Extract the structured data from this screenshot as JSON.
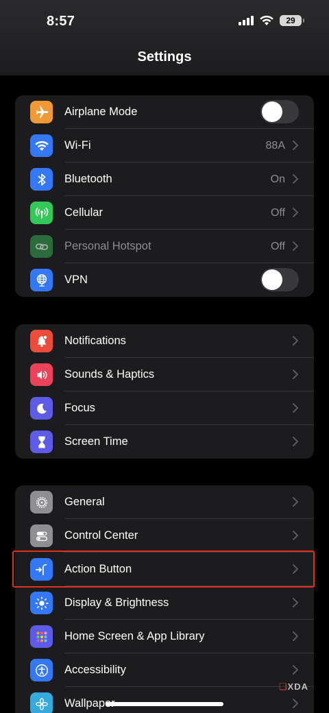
{
  "status_bar": {
    "time": "8:57",
    "battery": "29"
  },
  "page": {
    "title": "Settings"
  },
  "groups": [
    {
      "rows": [
        {
          "label": "Airplane Mode",
          "value": "",
          "icon": "airplane-icon",
          "color": "#f09a37",
          "control": "toggle",
          "toggle_on": false
        },
        {
          "label": "Wi-Fi",
          "value": "88A",
          "icon": "wifi-icon",
          "color": "#3478f6",
          "control": "chevron"
        },
        {
          "label": "Bluetooth",
          "value": "On",
          "icon": "bluetooth-icon",
          "color": "#3478f6",
          "control": "chevron"
        },
        {
          "label": "Cellular",
          "value": "Off",
          "icon": "cellular-icon",
          "color": "#34c759",
          "control": "chevron"
        },
        {
          "label": "Personal Hotspot",
          "value": "Off",
          "icon": "hotspot-icon",
          "color": "#2c6b3c",
          "control": "chevron",
          "dimmed": true
        },
        {
          "label": "VPN",
          "value": "",
          "icon": "vpn-globe-icon",
          "color": "#3478f6",
          "control": "toggle",
          "toggle_on": false
        }
      ]
    },
    {
      "rows": [
        {
          "label": "Notifications",
          "icon": "bell-icon",
          "color": "#eb4d3d",
          "control": "chevron"
        },
        {
          "label": "Sounds & Haptics",
          "icon": "speaker-icon",
          "color": "#eb445a",
          "control": "chevron"
        },
        {
          "label": "Focus",
          "icon": "moon-icon",
          "color": "#5e5ce6",
          "control": "chevron"
        },
        {
          "label": "Screen Time",
          "icon": "hourglass-icon",
          "color": "#5e5ce6",
          "control": "chevron"
        }
      ]
    },
    {
      "rows": [
        {
          "label": "General",
          "icon": "gear-icon",
          "color": "#8e8e93",
          "control": "chevron"
        },
        {
          "label": "Control Center",
          "icon": "switches-icon",
          "color": "#8e8e93",
          "control": "chevron"
        },
        {
          "label": "Action Button",
          "icon": "action-button-icon",
          "color": "#3478f6",
          "control": "chevron",
          "highlighted": true
        },
        {
          "label": "Display & Brightness",
          "icon": "sun-icon",
          "color": "#3478f6",
          "control": "chevron"
        },
        {
          "label": "Home Screen & App Library",
          "icon": "app-grid-icon",
          "color": "#5e5ce6",
          "control": "chevron"
        },
        {
          "label": "Accessibility",
          "icon": "accessibility-icon",
          "color": "#3478f6",
          "control": "chevron"
        },
        {
          "label": "Wallpaper",
          "icon": "flower-icon",
          "color": "#36aadc",
          "control": "chevron"
        }
      ]
    }
  ],
  "watermark": {
    "mark": "❑",
    "text": "XDA"
  },
  "colors": {
    "highlight_border": "#e0301e",
    "group_bg": "#1c1c1e"
  }
}
